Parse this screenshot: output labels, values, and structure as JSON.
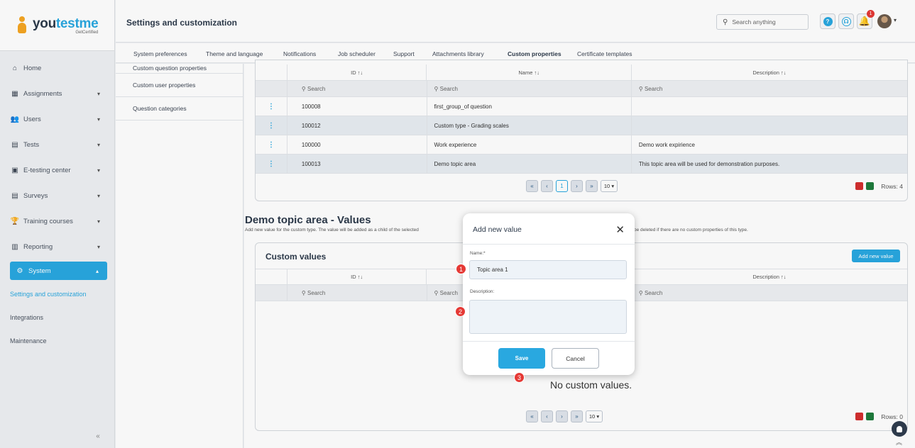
{
  "brand": {
    "name_part1": "you",
    "name_accent": "testme",
    "tagline": "GetCertified"
  },
  "sidebar": {
    "items": [
      {
        "label": "Home",
        "icon": "home-icon",
        "glyph": "⌂"
      },
      {
        "label": "Assignments",
        "icon": "assignments-icon",
        "glyph": "▦",
        "chevron": "▾"
      },
      {
        "label": "Users",
        "icon": "users-icon",
        "glyph": "👥",
        "chevron": "▾"
      },
      {
        "label": "Tests",
        "icon": "tests-icon",
        "glyph": "▤",
        "chevron": "▾"
      },
      {
        "label": "E-testing center",
        "icon": "etesting-icon",
        "glyph": "▣",
        "chevron": "▾"
      },
      {
        "label": "Surveys",
        "icon": "surveys-icon",
        "glyph": "▤",
        "chevron": "▾"
      },
      {
        "label": "Training courses",
        "icon": "training-icon",
        "glyph": "🏆",
        "chevron": "▾"
      },
      {
        "label": "Reporting",
        "icon": "reporting-icon",
        "glyph": "▥",
        "chevron": "▾"
      },
      {
        "label": "System",
        "icon": "system-icon",
        "glyph": "⚙",
        "chevron": "▴"
      }
    ],
    "subitems": [
      "Settings and customization",
      "Integrations",
      "Maintenance"
    ],
    "collapse_glyph": "«"
  },
  "header": {
    "title": "Settings and customization",
    "search_placeholder": "Search anything",
    "help_glyph": "?",
    "support_glyph": "☊",
    "notifications_count": "1"
  },
  "tabs": [
    "System preferences",
    "Theme and language",
    "Notifications",
    "Job scheduler",
    "Support",
    "Attachments library",
    "Custom properties",
    "Certificate templates"
  ],
  "sub_sidebar": [
    "Custom question properties",
    "Custom user properties",
    "Question categories"
  ],
  "types_table": {
    "columns": [
      "ID ↑↓",
      "Name ↑↓",
      "Description ↑↓"
    ],
    "search_label": "Search",
    "rows": [
      {
        "id": "100008",
        "name": "first_group_of question",
        "description": ""
      },
      {
        "id": "100012",
        "name": "Custom type - Grading scales",
        "description": ""
      },
      {
        "id": "100000",
        "name": "Work experience",
        "description": "Demo work expirience"
      },
      {
        "id": "100013",
        "name": "Demo topic area",
        "description": "This topic area will be used for demonstration purposes."
      }
    ],
    "rows_label": "Rows: 4",
    "page": "1",
    "page_size": "10 ▾"
  },
  "values_section": {
    "title": "Demo topic area - Values",
    "desc_left": "Add new value for the custom type. The value will be added as a child of the selected",
    "desc_right": "be deleted if there are no custom properties of this type.",
    "panel_title": "Custom values",
    "add_button": "Add new value",
    "columns": [
      "ID ↑↓",
      "Description ↑↓"
    ],
    "empty_text": "No custom values.",
    "rows_label": "Rows: 0",
    "page_size": "10 ▾"
  },
  "pager_glyphs": {
    "first": "«",
    "prev": "‹",
    "next": "›",
    "last": "»"
  },
  "modal": {
    "title": "Add new value",
    "close_glyph": "✕",
    "name_label": "Name:*",
    "name_value": "Topic area 1",
    "description_label": "Description:",
    "save_label": "Save",
    "cancel_label": "Cancel"
  },
  "steps": [
    "1",
    "2",
    "3"
  ],
  "colors": {
    "accent": "#29a8e0",
    "badge": "#e53935",
    "dark": "#2d3a4b"
  },
  "scroll_top_glyph": "︽"
}
